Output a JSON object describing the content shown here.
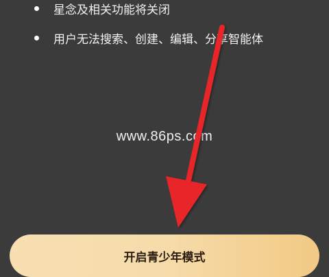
{
  "feature_list": {
    "items": [
      {
        "label": "星念及相关功能将关闭"
      },
      {
        "label": "用户无法搜索、创建、编辑、分享智能体"
      }
    ]
  },
  "watermark": {
    "text": "www.86ps.com"
  },
  "primary_action": {
    "label": "开启青少年模式"
  },
  "colors": {
    "background": "#3b3b3b",
    "button_gradient_start": "#f7dfb3",
    "button_gradient_end": "#f2c984",
    "arrow": "#e8262a"
  }
}
